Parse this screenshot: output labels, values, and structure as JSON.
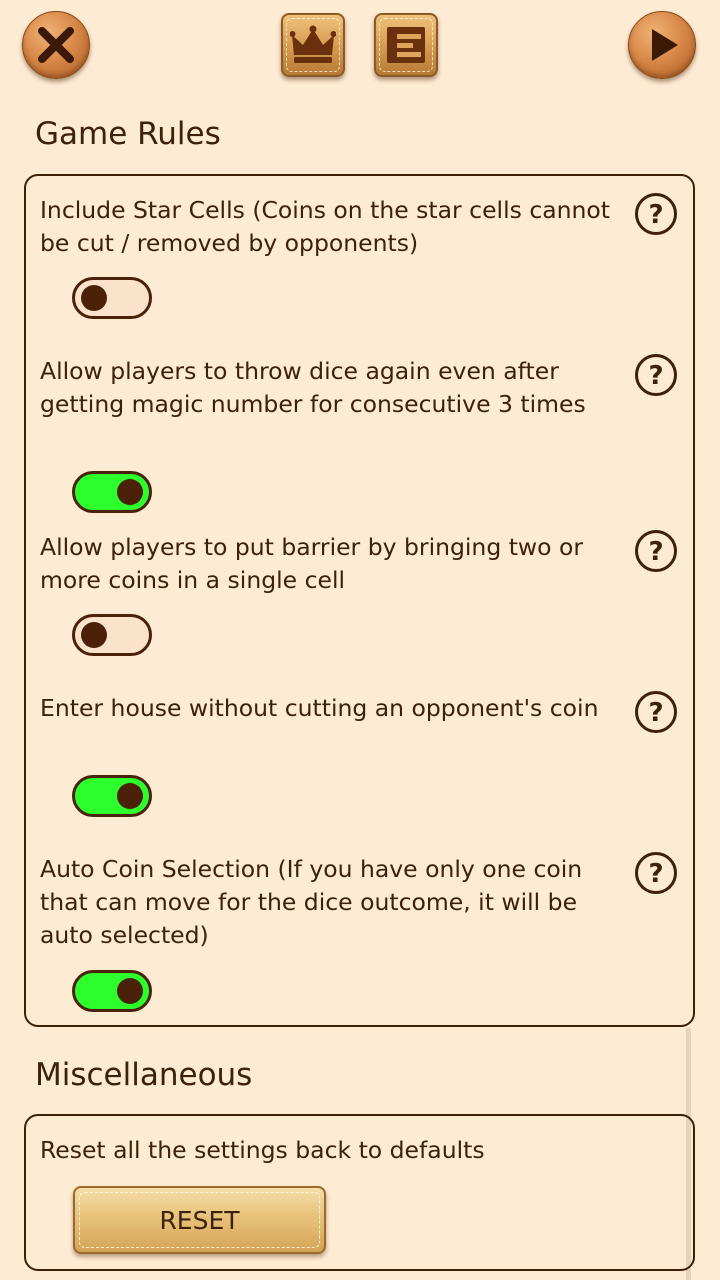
{
  "topbar": {
    "close_icon": "x-icon",
    "leaderboard_icon": "crown-icon",
    "menu_icon": "wooden-stack-icon",
    "play_icon": "play-triangle-icon"
  },
  "game_rules": {
    "title": "Game Rules",
    "rules": [
      {
        "text": "Include Star Cells (Coins on the star cells cannot be cut / removed by opponents)",
        "enabled": false
      },
      {
        "text": "Allow players to throw dice again even after getting magic number for consecutive 3 times",
        "enabled": true
      },
      {
        "text": "Allow players to put barrier by bringing two or more coins in a single cell",
        "enabled": false
      },
      {
        "text": "Enter house without cutting an opponent's coin",
        "enabled": true
      },
      {
        "text": "Auto Coin Selection (If you have only one coin that can move for the dice outcome, it will be auto selected)",
        "enabled": true
      }
    ],
    "help_icon": "question-circle-icon"
  },
  "misc": {
    "title": "Miscellaneous",
    "reset_description": "Reset all the settings back to defaults",
    "reset_button": "RESET"
  },
  "colors": {
    "background": "#fdebd3",
    "text": "#3d2108",
    "toggle_on": "#2dff2d",
    "toggle_off": "#fbe3cb",
    "knob": "#4b2209"
  }
}
